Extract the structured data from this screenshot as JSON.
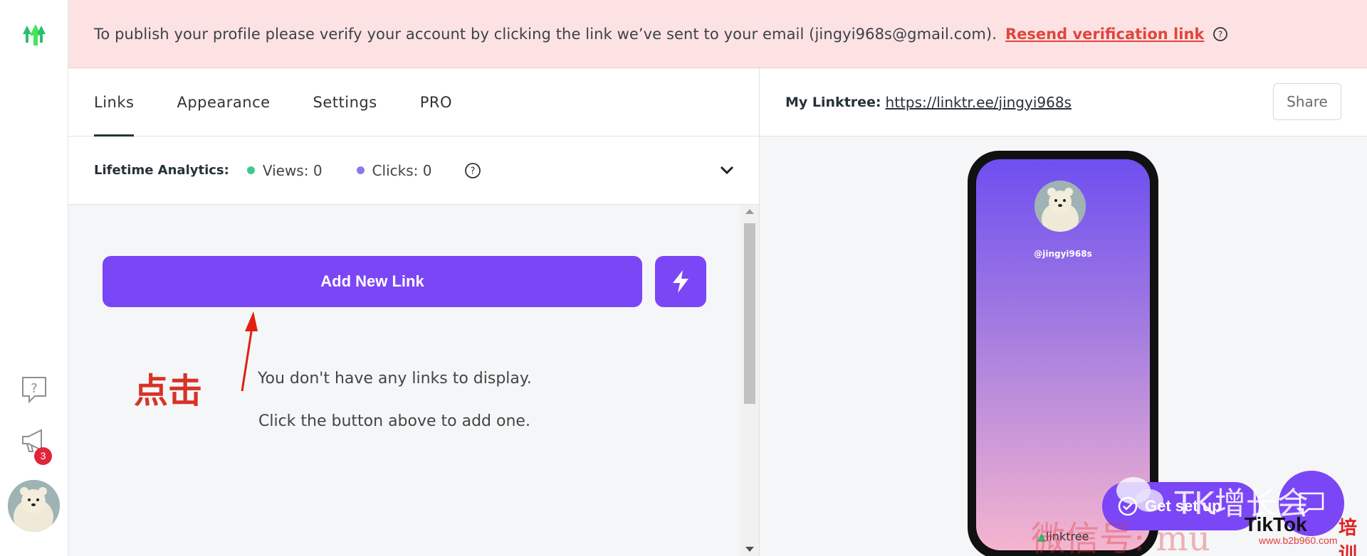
{
  "banner": {
    "message": "To publish your profile please verify your account by clicking the link we’ve sent to your email (jingyi968s@gmail.com).",
    "resend_link": "Resend verification link"
  },
  "rail": {
    "badge_count": "3"
  },
  "tabs": [
    {
      "label": "Links",
      "active": true
    },
    {
      "label": "Appearance",
      "active": false
    },
    {
      "label": "Settings",
      "active": false
    },
    {
      "label": "PRO",
      "active": false
    }
  ],
  "analytics": {
    "label": "Lifetime Analytics:",
    "views": "Views: 0",
    "clicks": "Clicks: 0",
    "views_dot_color": "#3fc98e",
    "clicks_dot_color": "#8a7be8"
  },
  "links": {
    "add_button": "Add New Link",
    "empty_line1": "You don't have any links to display.",
    "empty_line2": "Click the button above to add one.",
    "annotation": "点击"
  },
  "preview": {
    "label": "My Linktree:",
    "url": "https://linktr.ee/jingyi968s",
    "share": "Share",
    "handle": "@jingyi968s",
    "footer": "linktree"
  },
  "floating": {
    "get_set_up": "Get set up"
  },
  "watermark": {
    "brand": "TK增长会",
    "wechat": "微信号: mu",
    "tiktok": "TikTok",
    "training": "培训",
    "site": "www.b2b960.com"
  },
  "colors": {
    "accent": "#7b46f5",
    "banner_bg": "#fde2e4",
    "banner_link": "#e1453c",
    "logo_green": "#43e55e"
  }
}
